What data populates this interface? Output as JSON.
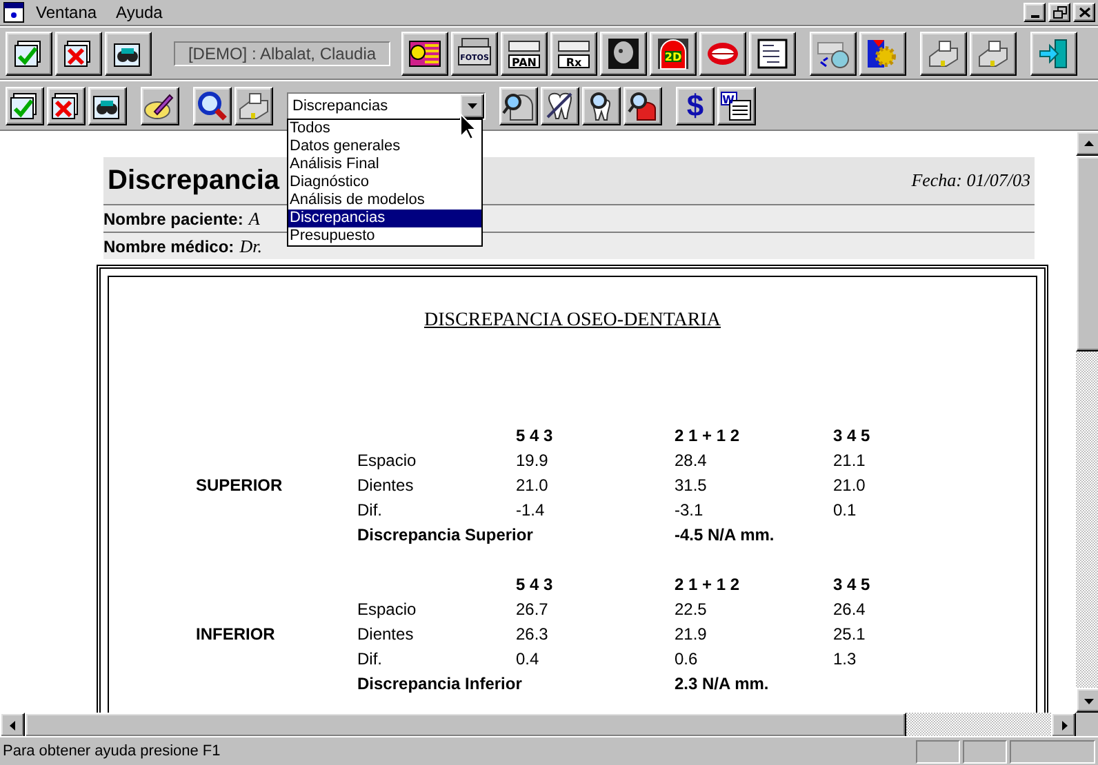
{
  "menu": [
    {
      "label": "Ventana"
    },
    {
      "label": "Ayuda"
    }
  ],
  "toolbar_1": [
    {
      "kind": "check"
    },
    {
      "kind": "cross"
    },
    {
      "kind": "binoculars"
    },
    {
      "kind": "patient"
    },
    {
      "kind": "idcard"
    },
    {
      "kind": "film",
      "label": "FOTOS"
    },
    {
      "kind": "pan",
      "label": "PAN"
    },
    {
      "kind": "rx",
      "label": "Rx"
    },
    {
      "kind": "skull"
    },
    {
      "kind": "arch",
      "label": "2D"
    },
    {
      "kind": "mouth"
    },
    {
      "kind": "document"
    },
    {
      "kind": "disc"
    },
    {
      "kind": "gear"
    },
    {
      "kind": "printer"
    },
    {
      "kind": "printer"
    },
    {
      "kind": "exit"
    }
  ],
  "patient_field": "[DEMO] : Albalat, Claudia",
  "toolbar_2": [
    {
      "kind": "check"
    },
    {
      "kind": "cross"
    },
    {
      "kind": "binoculars"
    },
    {
      "kind": "pencil"
    },
    {
      "kind": "magnifier"
    },
    {
      "kind": "printer"
    },
    {
      "kind": "combo"
    },
    {
      "kind": "headsearch"
    },
    {
      "kind": "tooth"
    },
    {
      "kind": "toothsearch"
    },
    {
      "kind": "redsearch"
    },
    {
      "kind": "text",
      "label": "$"
    },
    {
      "kind": "word",
      "label": "W"
    }
  ],
  "report_select": {
    "value": "Discrepancias",
    "options": [
      {
        "label": "Todos",
        "selected": false
      },
      {
        "label": "Datos generales",
        "selected": false
      },
      {
        "label": "Análisis Final",
        "selected": false
      },
      {
        "label": "Diagnóstico",
        "selected": false
      },
      {
        "label": "Análisis de modelos",
        "selected": false
      },
      {
        "label": "Discrepancias",
        "selected": true
      },
      {
        "label": "Presupuesto",
        "selected": false
      }
    ]
  },
  "document": {
    "heading": "Discrepancia",
    "date": "Fecha: 01/07/03",
    "fields": [
      {
        "label": "Nombre paciente:",
        "value": "A"
      },
      {
        "label": "Nombre médico:",
        "value": "Dr."
      }
    ],
    "title": "DISCREPANCIA OSEO-DENTARIA",
    "sections": [
      {
        "name": "SUPERIOR",
        "columns": [
          "5 4 3",
          "2 1 + 1 2",
          "3 4 5"
        ],
        "rows": [
          {
            "label": "Espacio",
            "values": [
              "19.9",
              "28.4",
              "21.1"
            ]
          },
          {
            "label": "Dientes",
            "values": [
              "21.0",
              "31.5",
              "21.0"
            ]
          },
          {
            "label": "Dif.",
            "values": [
              "-1.4",
              "-3.1",
              "0.1"
            ]
          }
        ],
        "total_label": "Discrepancia Superior",
        "total": "-4.5 N/A mm."
      },
      {
        "name": "INFERIOR",
        "columns": [
          "5 4 3",
          "2 1 + 1 2",
          "3 4 5"
        ],
        "rows": [
          {
            "label": "Espacio",
            "values": [
              "26.7",
              "22.5",
              "26.4"
            ]
          },
          {
            "label": "Dientes",
            "values": [
              "26.3",
              "21.9",
              "25.1"
            ]
          },
          {
            "label": "Dif.",
            "values": [
              "0.4",
              "0.6",
              "1.3"
            ]
          }
        ],
        "total_label": "Discrepancia Inferior",
        "total": "2.3 N/A mm."
      }
    ]
  },
  "status_bar": {
    "text": "Para obtener ayuda presione F1"
  }
}
